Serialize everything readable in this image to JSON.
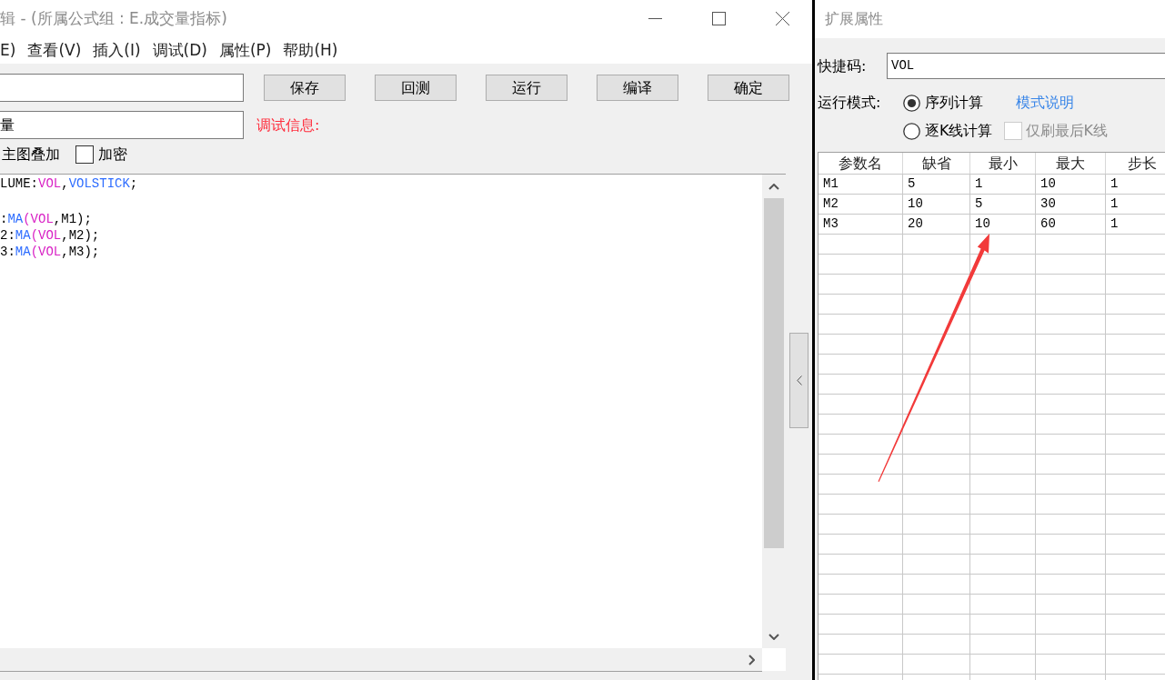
{
  "window": {
    "title": "辑 - (所属公式组 : E.成交量指标)"
  },
  "menu": [
    "E)",
    "查看(V)",
    "插入(I)",
    "调试(D)",
    "属性(P)",
    "帮助(H)"
  ],
  "description_field": {
    "value": "量"
  },
  "buttons": [
    "保存",
    "回测",
    "运行",
    "编译",
    "确定"
  ],
  "debug_label": "调试信息:",
  "overlay_label": "主图叠加",
  "encrypt_checkbox": {
    "label": "加密",
    "checked": false
  },
  "editor": {
    "lines": [
      {
        "kind": "code",
        "tokens": [
          {
            "kind": "plain",
            "text": "LUME:"
          },
          {
            "kind": "variable",
            "text": "VOL"
          },
          {
            "kind": "plain",
            "text": ","
          },
          {
            "kind": "function",
            "text": "VOLSTICK"
          },
          {
            "kind": "plain",
            "text": ";"
          }
        ]
      },
      {
        "kind": "blank"
      },
      {
        "kind": "code",
        "tokens": [
          {
            "kind": "plain",
            "text": ":"
          },
          {
            "kind": "function",
            "text": "MA"
          },
          {
            "kind": "variable",
            "text": "(VOL"
          },
          {
            "kind": "plain",
            "text": ",M1);"
          }
        ]
      },
      {
        "kind": "code",
        "tokens": [
          {
            "kind": "plain",
            "text": "2:"
          },
          {
            "kind": "function",
            "text": "MA"
          },
          {
            "kind": "variable",
            "text": "(VOL"
          },
          {
            "kind": "plain",
            "text": ",M2);"
          }
        ]
      },
      {
        "kind": "code",
        "tokens": [
          {
            "kind": "plain",
            "text": "3:"
          },
          {
            "kind": "function",
            "text": "MA"
          },
          {
            "kind": "variable",
            "text": "(VOL"
          },
          {
            "kind": "plain",
            "text": ",M3);"
          }
        ]
      }
    ]
  },
  "panel": {
    "title": "扩展属性",
    "shortcut": {
      "label": "快捷码:",
      "value": "VOL"
    },
    "run_mode": {
      "label": "运行模式:",
      "options": [
        {
          "label": "序列计算",
          "selected": true
        },
        {
          "label": "逐K线计算",
          "selected": false
        }
      ],
      "help_link": "模式说明"
    },
    "refresh_last_checkbox": {
      "label": "仅刷最后K线",
      "checked": false,
      "disabled": true
    },
    "params_table": {
      "columns": [
        "参数名",
        "缺省",
        "最小",
        "最大",
        "步长"
      ],
      "rows": [
        [
          "M1",
          "5",
          "1",
          "10",
          "1"
        ],
        [
          "M2",
          "10",
          "5",
          "30",
          "1"
        ],
        [
          "M3",
          "20",
          "10",
          "60",
          "1"
        ]
      ]
    }
  }
}
